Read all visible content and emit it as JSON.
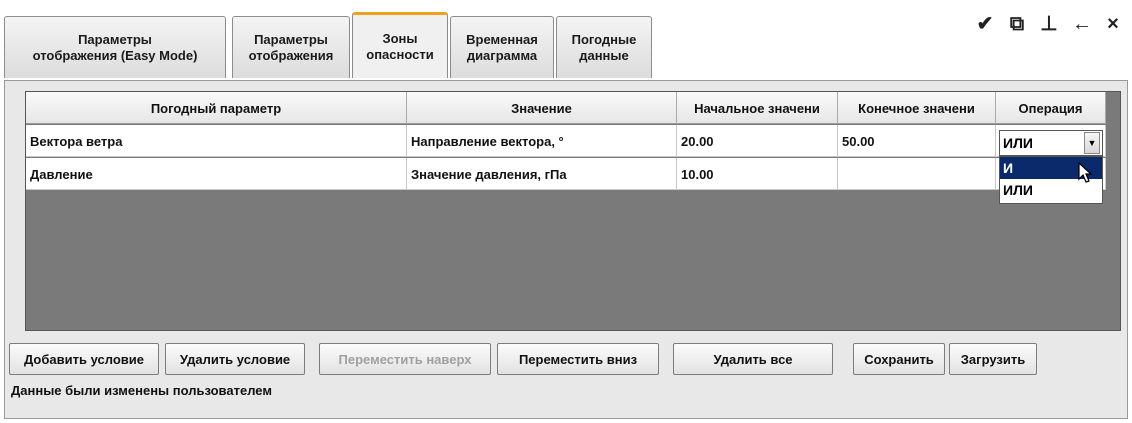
{
  "tabs": [
    {
      "label": "Параметры\nотображения (Easy Mode)",
      "active": false
    },
    {
      "label": "Параметры\nотображения",
      "active": false
    },
    {
      "label": "Зоны\nопасности",
      "active": true
    },
    {
      "label": "Временная\nдиаграмма",
      "active": false
    },
    {
      "label": "Погодные\nданные",
      "active": false
    }
  ],
  "toolbar": {
    "icons": [
      "brush-icon",
      "restore-window-icon",
      "pin-icon",
      "back-arrow-icon",
      "close-icon"
    ],
    "glyphs": [
      "✔",
      "⧉",
      "⊥",
      "←",
      "×"
    ]
  },
  "table": {
    "columns": [
      "Погодный параметр",
      "Значение",
      "Начальное значени",
      "Конечное значени",
      "Операция"
    ],
    "rows": [
      [
        "Вектора ветра",
        "Направление вектора, °",
        "20.00",
        "50.00",
        "ИЛИ"
      ],
      [
        "Давление",
        "Значение давления, гПа",
        "10.00",
        "",
        ""
      ]
    ]
  },
  "operation_dropdown": {
    "current": "ИЛИ",
    "options": [
      "И",
      "ИЛИ"
    ],
    "highlighted": "И"
  },
  "buttons": {
    "add": "Добавить условие",
    "delete": "Удалить условие",
    "move_up": "Переместить наверх",
    "move_down": "Переместить вниз",
    "delete_all": "Удалить все",
    "save": "Сохранить",
    "load": "Загрузить"
  },
  "status_text": "Данные были изменены пользователем",
  "colors": {
    "active_tab_accent": "#f0a020",
    "selection": "#0a2a6b",
    "grid_background": "#7a7a7a"
  }
}
